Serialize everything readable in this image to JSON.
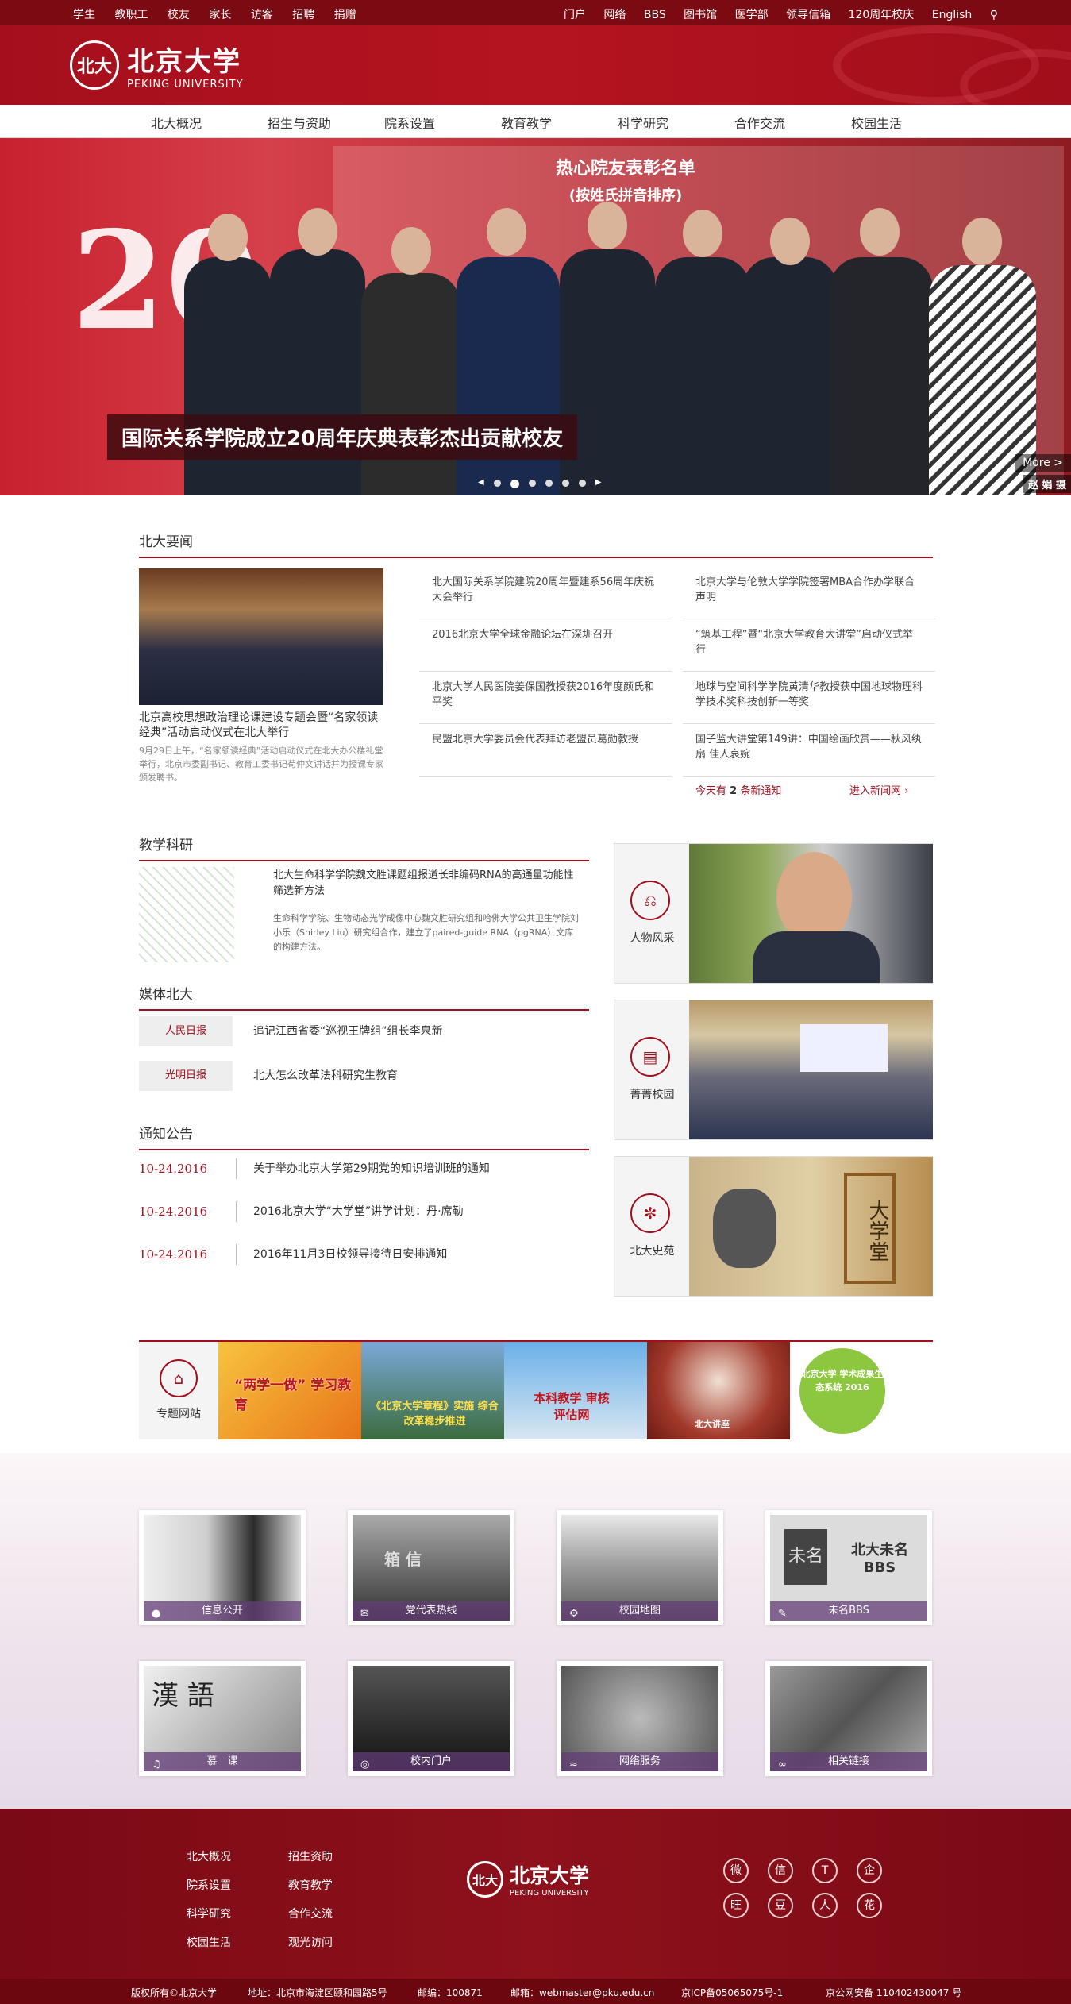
{
  "topbar": {
    "left": [
      "学生",
      "教职工",
      "校友",
      "家长",
      "访客",
      "招聘",
      "捐赠"
    ],
    "right": [
      "门户",
      "网络",
      "BBS",
      "图书馆",
      "医学部",
      "领导信箱",
      "120周年校庆",
      "English"
    ]
  },
  "logo": {
    "cn": "北京大学",
    "en": "PEKING UNIVERSITY",
    "seal": "北大"
  },
  "nav": [
    "北大概况",
    "招生与资助",
    "院系设置",
    "教育教学",
    "科学研究",
    "合作交流",
    "校园生活"
  ],
  "banner": {
    "caption": "国际关系学院成立20周年庆典表彰杰出贡献校友",
    "board_title": "热心院友表彰名单",
    "board_sub": "(按姓氏拼音排序)",
    "number": "20",
    "more": "More >",
    "credit": "赵 娟 摄"
  },
  "news": {
    "title": "北大要闻",
    "featured_caption": "北京高校思想政治理论课建设专题会暨“名家领读经典”活动启动仪式在北大举行",
    "featured_desc": "9月29日上午，“名家领读经典”活动启动仪式在北大办公楼礼堂举行，北京市委副书记、教育工委书记苟仲文讲话并为授课专家颁发聘书。",
    "col1": [
      "北大国际关系学院建院20周年暨建系56周年庆祝大会举行",
      "2016北京大学全球金融论坛在深圳召开",
      "北京大学人民医院姜保国教授获2016年度颜氏和平奖",
      "民盟北京大学委员会代表拜访老盟员葛勋教授"
    ],
    "col2": [
      "北京大学与伦敦大学学院签署MBA合作办学联合声明",
      "“筑基工程”暨“北京大学教育大讲堂”启动仪式举行",
      "地球与空间科学学院黄清华教授获中国地球物理科学技术奖科技创新一等奖",
      "国子监大讲堂第149讲：中国绘画欣赏——秋风纨扇 佳人哀婉"
    ],
    "today_prefix": "今天有",
    "today_count": "2",
    "today_suffix": "条新通知",
    "enter": "进入新闻网"
  },
  "teaching": {
    "title": "教学科研",
    "headline": "北大生命科学学院魏文胜课题组报道长非编码RNA的高通量功能性筛选新方法",
    "desc": "生命科学学院、生物动态光学成像中心魏文胜研究组和哈佛大学公共卫生学院刘小乐（Shirley Liu）研究组合作，建立了paired-guide RNA（pgRNA）文库的构建方法。"
  },
  "media": {
    "title": "媒体北大",
    "items": [
      {
        "tag": "人民日报",
        "text": "追记江西省委“巡视王牌组”组长李泉新"
      },
      {
        "tag": "光明日报",
        "text": "北大怎么改革法科研究生教育"
      }
    ]
  },
  "notices": {
    "title": "通知公告",
    "items": [
      {
        "date": "10-24.2016",
        "text": "关于举办北京大学第29期党的知识培训班的通知"
      },
      {
        "date": "10-24.2016",
        "text": "2016北京大学“大学堂”讲学计划：丹·席勒"
      },
      {
        "date": "10-24.2016",
        "text": "2016年11月3日校领导接待日安排通知"
      }
    ]
  },
  "cards": [
    {
      "label": "人物风采",
      "icon": "chair-icon"
    },
    {
      "label": "菁菁校园",
      "icon": "book-icon"
    },
    {
      "label": "北大史苑",
      "icon": "seal-icon"
    }
  ],
  "card3_text": "大学堂",
  "special": {
    "label": "专题网站",
    "items": [
      "“两学一做” 学习教育",
      "《北京大学章程》实施 综合改革稳步推进",
      "本科教学 审核评估网",
      "北大讲座",
      "北京大学 学术成果生态系统 2016"
    ]
  },
  "services": [
    {
      "label": "信息公开",
      "icon": "person-icon"
    },
    {
      "label": "党代表热线",
      "icon": "mail-icon"
    },
    {
      "label": "校园地图",
      "icon": "gear-icon"
    },
    {
      "label": "未名BBS",
      "icon": "chat-icon"
    },
    {
      "label": "慕　课",
      "icon": "bell-icon"
    },
    {
      "label": "校内门户",
      "icon": "globe-icon"
    },
    {
      "label": "网络服务",
      "icon": "wifi-icon"
    },
    {
      "label": "相关链接",
      "icon": "link-icon"
    }
  ],
  "service_img_text": {
    "bbs": "北大未名 BBS",
    "bbs_glyph": "未名",
    "box": "箱 信",
    "hanyu": "漢 語"
  },
  "footer": {
    "col1": [
      "北大概况",
      "院系设置",
      "科学研究",
      "校园生活"
    ],
    "col2": [
      "招生资助",
      "教育教学",
      "合作交流",
      "观光访问"
    ],
    "social": [
      "微",
      "信",
      "T",
      "企",
      "旺",
      "豆",
      "人",
      "花"
    ]
  },
  "bottom": {
    "copyright": "版权所有©北京大学",
    "address": "地址：北京市海淀区颐和园路5号",
    "zip": "邮编：100871",
    "email": "邮箱：webmaster@pku.edu.cn",
    "icp": "京ICP备05065075号-1",
    "police": "京公网安备 110402430047 号"
  }
}
